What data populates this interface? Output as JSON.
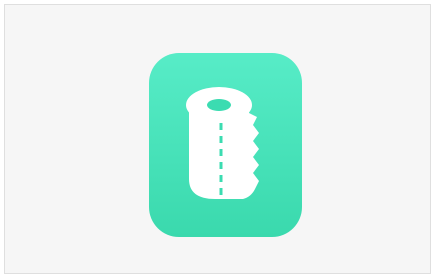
{
  "screen": {
    "background_color": "#f6f6f6",
    "frame_border_color": "#dfdfdf"
  },
  "app_icon": {
    "icon_name": "toilet-paper-roll-icon",
    "gradient_top_color": "#57ecc7",
    "gradient_bottom_color": "#3ad9ad",
    "glyph_color": "#ffffff",
    "perforation_color": "#3bdcb1"
  }
}
